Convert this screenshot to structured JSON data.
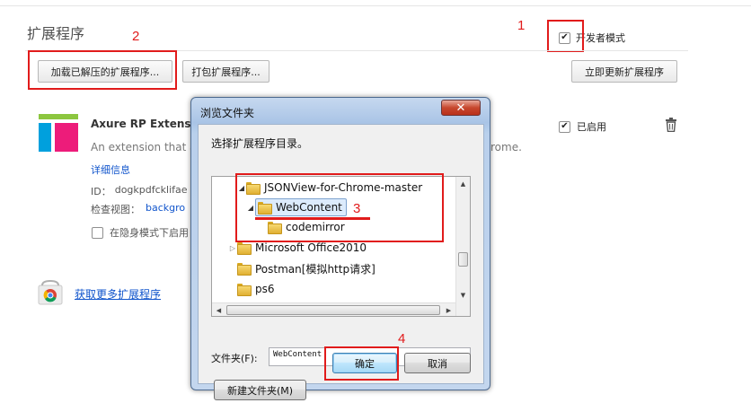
{
  "page": {
    "title": "扩展程序"
  },
  "developer_mode": {
    "label": "开发者模式",
    "checked": true
  },
  "toolbar": {
    "load_unpacked_label": "加载已解压的扩展程序...",
    "pack_label": "打包扩展程序...",
    "update_label": "立即更新扩展程序"
  },
  "extension": {
    "name": "Axure RP Extensio",
    "description": "An extension that a",
    "description_tail": "rome.",
    "details_link": "详细信息",
    "id_label": "ID：",
    "id_value": "dogkpdfcklifaen",
    "inspect_label": "检查视图：",
    "inspect_link": "backgro",
    "incognito_label": "在隐身模式下启用",
    "incognito_checked": false,
    "enabled_label": "已启用",
    "enabled_checked": true,
    "icon": "axure-logo-icon",
    "trash_icon": "trash-icon"
  },
  "more_extensions": {
    "label": "获取更多扩展程序",
    "icon": "chrome-webstore-icon"
  },
  "dialog": {
    "title": "浏览文件夹",
    "close_glyph": "✕",
    "prompt": "选择扩展程序目录。",
    "tree": [
      {
        "label": "JSONView-for-Chrome-master",
        "expanded": true
      },
      {
        "label": "WebContent",
        "expanded": true,
        "selected": true
      },
      {
        "label": "codemirror"
      },
      {
        "label": "Microsoft Office2010",
        "expanded": false
      },
      {
        "label": "Postman[模拟http请求]"
      },
      {
        "label": "ps6"
      }
    ],
    "folder_label": "文件夹(F):",
    "folder_value": "WebContent",
    "new_folder_label": "新建文件夹(M)",
    "ok_label": "确定",
    "cancel_label": "取消"
  },
  "annotations": {
    "step1": "1",
    "step2": "2",
    "step3": "3",
    "step4": "4",
    "color": "#e11b1b"
  },
  "colors": {
    "accent_link": "#1155cc",
    "annotation_red": "#e11b1b",
    "dialog_frame": "#b9d0ec"
  }
}
